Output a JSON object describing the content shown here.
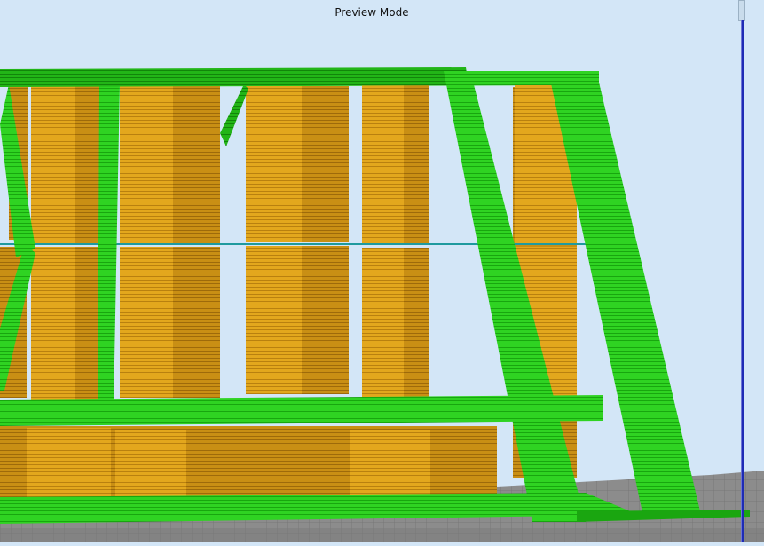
{
  "viewport": {
    "mode_label": "Preview Mode"
  },
  "colors": {
    "background": "#d3e6f7",
    "support": "#2bd11f",
    "support_dark": "#17a50f",
    "model": "#e0a61c",
    "model_dark": "#b57a0f",
    "bed": "#8a8a8a",
    "slider": "#1e2bb5"
  },
  "icons": {
    "layer_slider": "vertical-layer-slider"
  }
}
